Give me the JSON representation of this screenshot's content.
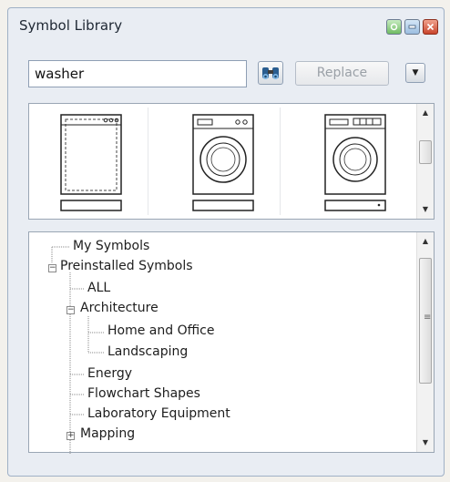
{
  "window": {
    "title": "Symbol Library",
    "buttons": [
      "restore-icon",
      "minimize-icon",
      "close-icon"
    ]
  },
  "toolbar": {
    "search_value": "washer",
    "find_icon": "binoculars-icon",
    "replace_label": "Replace",
    "menu_icon": "chevron-down-icon"
  },
  "gallery": {
    "symbols": [
      "dishwasher-icon",
      "front-load-washer-icon",
      "front-load-washer-alt-icon"
    ],
    "scroll_position": 0.35
  },
  "tree": {
    "items": [
      {
        "label": "My Symbols"
      },
      {
        "label": "Preinstalled Symbols",
        "expander": "−"
      },
      {
        "label": "ALL"
      },
      {
        "label": "Architecture",
        "expander": "−"
      },
      {
        "label": "Home and Office"
      },
      {
        "label": "Landscaping"
      },
      {
        "label": "Energy"
      },
      {
        "label": "Flowchart Shapes"
      },
      {
        "label": "Laboratory Equipment"
      },
      {
        "label": "Mapping",
        "expander": "+"
      }
    ]
  }
}
